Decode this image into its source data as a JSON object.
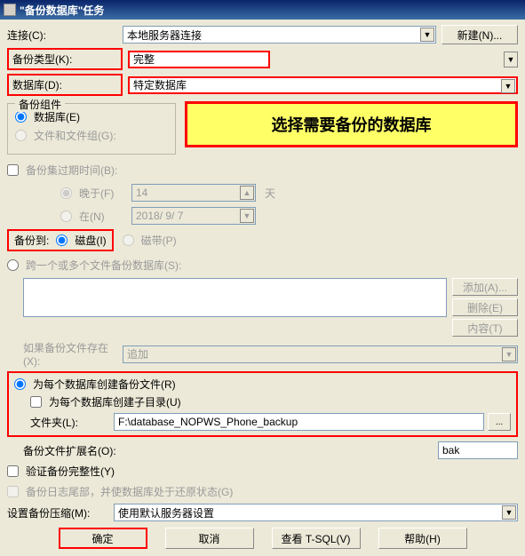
{
  "window": {
    "title": "\"备份数据库\"任务"
  },
  "connection": {
    "label": "连接(C):",
    "value": "本地服务器连接",
    "new_btn": "新建(N)..."
  },
  "backup_type": {
    "label": "备份类型(K):",
    "value": "完整"
  },
  "database": {
    "label": "数据库(D):",
    "value": "特定数据库"
  },
  "components": {
    "legend": "备份组件",
    "opt_db": "数据库(E)",
    "opt_files": "文件和文件组(G):"
  },
  "callout": "选择需要备份的数据库",
  "expire": {
    "check_label": "备份集过期时间(B):",
    "after_label": "晚于(F)",
    "after_value": "14",
    "days_suffix": "天",
    "on_label": "在(N)",
    "on_value": "2018/ 9/ 7"
  },
  "dest": {
    "label": "备份到:",
    "disk": "磁盘(I)",
    "tape": "磁带(P)"
  },
  "across": {
    "label": "跨一个或多个文件备份数据库(S):",
    "add_btn": "添加(A)...",
    "remove_btn": "删除(E)",
    "contents_btn": "内容(T)"
  },
  "if_exists": {
    "label": "如果备份文件存在(X):",
    "value": "追加"
  },
  "per_db": {
    "create_label": "为每个数据库创建备份文件(R)",
    "subdir_label": "为每个数据库创建子目录(U)",
    "folder_label": "文件夹(L):",
    "folder_value": "F:\\database_NOPWS_Phone_backup",
    "browse_btn": "..."
  },
  "ext": {
    "label": "备份文件扩展名(O):",
    "value": "bak"
  },
  "verify_label": "验证备份完整性(Y)",
  "tail_label": "备份日志尾部，并使数据库处于还原状态(G)",
  "compress": {
    "label": "设置备份压缩(M):",
    "value": "使用默认服务器设置"
  },
  "footer": {
    "ok": "确定",
    "cancel": "取消",
    "tsql": "查看 T-SQL(V)",
    "help": "帮助(H)"
  }
}
